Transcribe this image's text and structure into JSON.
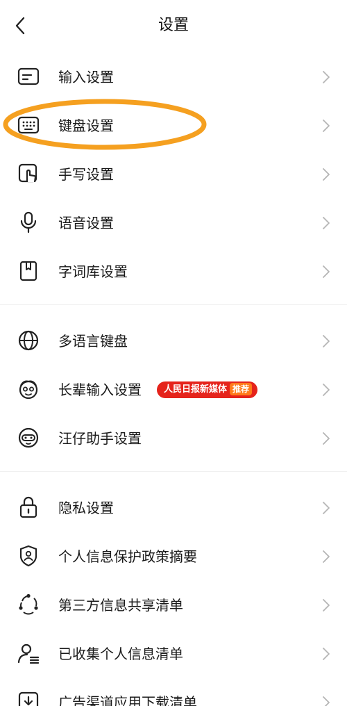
{
  "header": {
    "title": "设置"
  },
  "groups": [
    {
      "items": [
        {
          "label": "输入设置",
          "icon": "input-settings-icon"
        },
        {
          "label": "键盘设置",
          "icon": "keyboard-icon",
          "highlighted": true
        },
        {
          "label": "手写设置",
          "icon": "handwriting-icon"
        },
        {
          "label": "语音设置",
          "icon": "microphone-icon"
        },
        {
          "label": "字词库设置",
          "icon": "dictionary-icon"
        }
      ]
    },
    {
      "items": [
        {
          "label": "多语言键盘",
          "icon": "globe-icon"
        },
        {
          "label": "长辈输入设置",
          "icon": "elder-face-icon",
          "badge": {
            "text": "人民日报新媒体",
            "tag": "推荐"
          }
        },
        {
          "label": "汪仔助手设置",
          "icon": "assistant-dog-icon"
        }
      ]
    },
    {
      "items": [
        {
          "label": "隐私设置",
          "icon": "lock-icon"
        },
        {
          "label": "个人信息保护政策摘要",
          "icon": "shield-user-icon"
        },
        {
          "label": "第三方信息共享清单",
          "icon": "share-nodes-icon"
        },
        {
          "label": "已收集个人信息清单",
          "icon": "user-list-icon"
        },
        {
          "label": "广告渠道应用下载清单",
          "icon": "download-box-icon"
        }
      ]
    }
  ],
  "colors": {
    "highlight": "#f5a020",
    "badge": "#e5231b",
    "badge_tag": "#ff7a1a",
    "chevron": "#b5b5b5"
  }
}
